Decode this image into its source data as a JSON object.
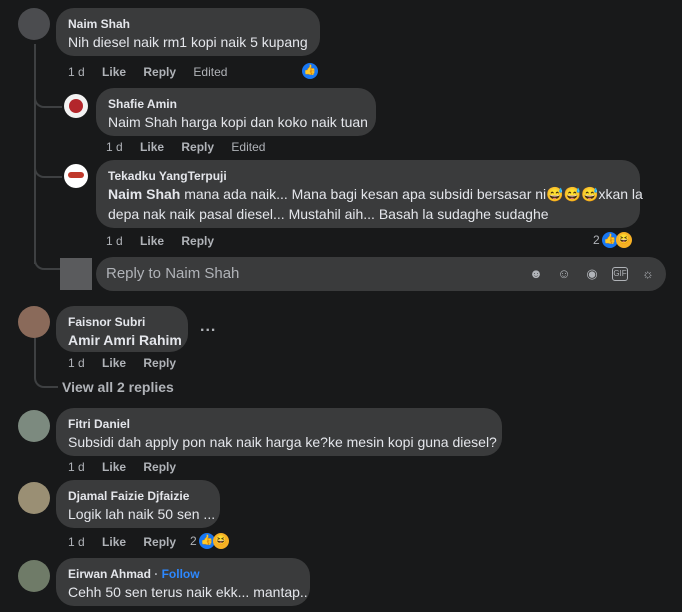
{
  "comments": [
    {
      "author": "Naim Shah",
      "text": "Nih diesel naik rm1 kopi naik 5 kupang",
      "time": "1 d",
      "like": "Like",
      "reply": "Reply",
      "edited": "Edited"
    },
    {
      "author": "Shafie Amin",
      "text": "Naim Shah harga kopi dan koko naik tuan",
      "time": "1 d",
      "like": "Like",
      "reply": "Reply",
      "edited": "Edited"
    },
    {
      "author": "Tekadku YangTerpuji",
      "mention": "Naim Shah",
      "text_line1": " mana ada naik... Mana bagi kesan apa subsidi bersasar ni",
      "text_line2_prefix": "xkan la",
      "text_line2": "depa nak naik pasal diesel... Mustahil aih... Basah la sudaghe sudaghe",
      "time": "1 d",
      "like": "Like",
      "reply": "Reply",
      "reaction_count": "2"
    },
    {
      "author": "Faisnor Subri",
      "text": "Amir Amri Rahim",
      "time": "1 d",
      "like": "Like",
      "reply": "Reply",
      "more": "..."
    },
    {
      "author": "Fitri Daniel",
      "text": "Subsidi dah apply pon nak naik harga ke?ke mesin kopi guna diesel?",
      "time": "1 d",
      "like": "Like",
      "reply": "Reply"
    },
    {
      "author": "Djamal Faizie Djfaizie",
      "text": "Logik lah naik 50 sen ...",
      "time": "1 d",
      "like": "Like",
      "reply": "Reply",
      "reaction_count": "2"
    },
    {
      "author": "Eirwan Ahmad",
      "follow": "Follow",
      "text": "Cehh 50 sen terus naik ekk... mantap.."
    }
  ],
  "composer": {
    "placeholder": "Reply to Naim Shah"
  },
  "view_replies": "View all 2 replies",
  "icons": {
    "like": "like-icon",
    "haha": "haha-icon",
    "laugh": "laughing-emoji",
    "emoji": "emoji-icon",
    "camera": "camera-icon",
    "gif": "gif-icon",
    "sticker": "sticker-icon",
    "avatar_sticker": "avatar-sticker-icon"
  },
  "colors": {
    "background": "#18191a",
    "bubble": "#3a3b3c",
    "text": "#e4e6eb",
    "muted": "#b0b3b8",
    "link": "#2d88ff",
    "like": "#1877f2"
  }
}
